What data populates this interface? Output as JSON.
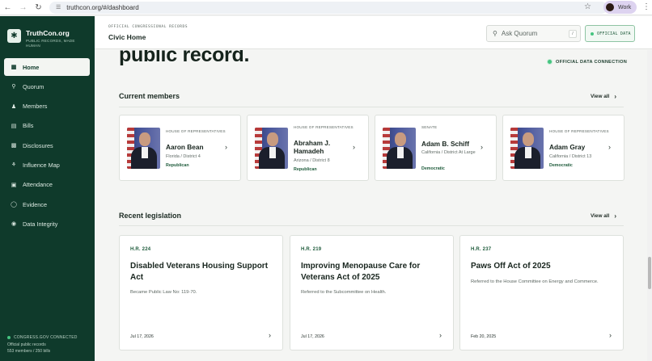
{
  "browser": {
    "back_icon": "arrow-left-icon",
    "url": "truthcon.org/#/dashboard",
    "profile_label": "Work"
  },
  "sidebar": {
    "brand_name": "TruthCon.org",
    "brand_tagline": "PUBLIC RECORDS, MADE HUMAN",
    "items": [
      {
        "label": "Home",
        "icon": "grid-icon",
        "active": true
      },
      {
        "label": "Quorum",
        "icon": "chat-search-icon"
      },
      {
        "label": "Members",
        "icon": "people-icon"
      },
      {
        "label": "Bills",
        "icon": "document-icon"
      },
      {
        "label": "Disclosures",
        "icon": "bar-chart-icon"
      },
      {
        "label": "Influence Map",
        "icon": "network-icon"
      },
      {
        "label": "Attendance",
        "icon": "calendar-icon"
      },
      {
        "label": "Evidence",
        "icon": "shield-icon"
      },
      {
        "label": "Data Integrity",
        "icon": "shield-check-icon"
      }
    ],
    "footer": {
      "status": "CONGRESS.GOV CONNECTED",
      "line1": "Official public records",
      "line2": "553 members / 250 bills"
    }
  },
  "header": {
    "eyebrow": "OFFICIAL CONGRESSIONAL RECORDS",
    "title": "Civic Home",
    "search_placeholder": "Ask Quorum",
    "search_shortcut": "/",
    "official_badge": "OFFICIAL DATA"
  },
  "hero": {
    "title_fragment": "public record.",
    "connection_label": "OFFICIAL DATA CONNECTION"
  },
  "members_section": {
    "title": "Current members",
    "view_all": "View all",
    "members": [
      {
        "chamber": "HOUSE OF REPRESENTATIVES",
        "name": "Aaron Bean",
        "place": "Florida / District 4",
        "party": "Republican"
      },
      {
        "chamber": "HOUSE OF REPRESENTATIVES",
        "name": "Abraham J. Hamadeh",
        "place": "Arizona / District 8",
        "party": "Republican"
      },
      {
        "chamber": "SENATE",
        "name": "Adam B. Schiff",
        "place": "California / District At Large",
        "party": "Democratic"
      },
      {
        "chamber": "HOUSE OF REPRESENTATIVES",
        "name": "Adam Gray",
        "place": "California / District 13",
        "party": "Democratic"
      }
    ]
  },
  "legislation_section": {
    "title": "Recent legislation",
    "view_all": "View all",
    "bills": [
      {
        "number": "H.R. 224",
        "title": "Disabled Veterans Housing Support Act",
        "status": "Became Public Law No: 119-70.",
        "date": "Jul 17, 2026"
      },
      {
        "number": "H.R. 219",
        "title": "Improving Menopause Care for Veterans Act of 2025",
        "status": "Referred to the Subcommittee on Health.",
        "date": "Jul 17, 2026"
      },
      {
        "number": "H.R. 237",
        "title": "Paws Off Act of 2025",
        "status": "Referred to the House Committee on Energy and Commerce.",
        "date": "Feb 20, 2025"
      }
    ]
  },
  "colors": {
    "sidebar_bg": "#0f3a2b",
    "accent_green": "#1e5b3b",
    "status_dot": "#45c480"
  }
}
